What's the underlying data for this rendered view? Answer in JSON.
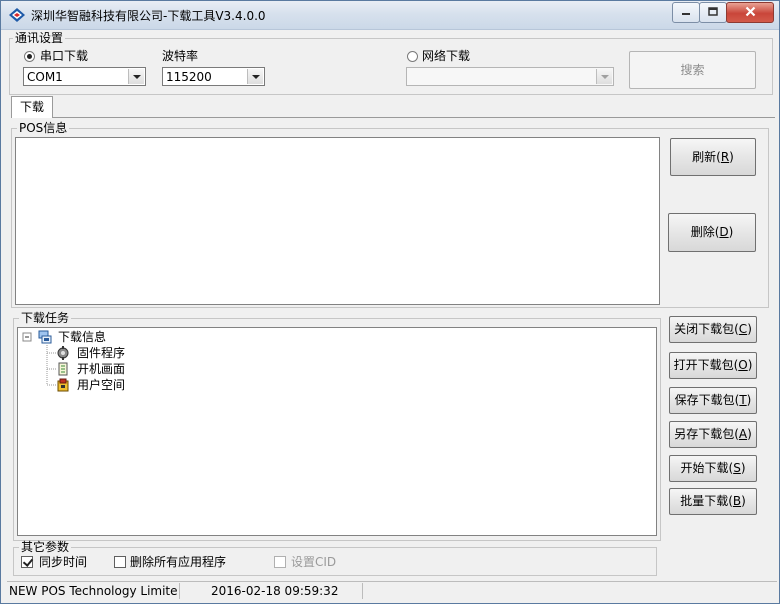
{
  "window": {
    "title": "深圳华智融科技有限公司-下载工具V3.4.0.0"
  },
  "comm": {
    "group_label": "通讯设置",
    "serial_radio": "串口下载",
    "baud_label": "波特率",
    "port_value": "COM1",
    "baud_value": "115200",
    "network_radio": "网络下载",
    "network_value": "",
    "search_button": "搜索"
  },
  "tabs": [
    {
      "label": "下载"
    }
  ],
  "pos_info": {
    "group_label": "POS信息",
    "refresh": {
      "text": "刷新(",
      "key": "R",
      "end": ")"
    },
    "delete": {
      "text": "删除(",
      "key": "D",
      "end": ")"
    }
  },
  "tasks": {
    "group_label": "下载任务",
    "tree": {
      "root": "下载信息",
      "children": [
        "固件程序",
        "开机画面",
        "用户空间"
      ]
    },
    "buttons": [
      {
        "text": "关闭下载包(",
        "key": "C",
        "end": ")"
      },
      {
        "text": "打开下载包(",
        "key": "O",
        "end": ")"
      },
      {
        "text": "保存下载包(",
        "key": "T",
        "end": ")"
      },
      {
        "text": "另存下载包(",
        "key": "A",
        "end": ")"
      },
      {
        "text": "开始下载(",
        "key": "S",
        "end": ")"
      },
      {
        "text": "批量下载(",
        "key": "B",
        "end": ")"
      }
    ]
  },
  "other": {
    "group_label": "其它参数",
    "sync_time": "同步时间",
    "delete_apps": "删除所有应用程序",
    "set_cid": "设置CID"
  },
  "status": {
    "company": "NEW POS Technology Limite",
    "datetime": "2016-02-18 09:59:32"
  },
  "colors": {
    "accent": "#1e5aa8",
    "titlebar": "#dbe4ef"
  }
}
